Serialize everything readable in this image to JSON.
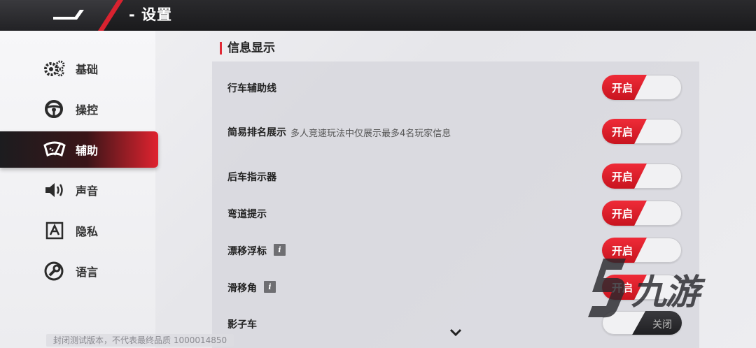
{
  "header": {
    "title": "- 设置"
  },
  "sidebar": {
    "items": [
      {
        "label": "基础",
        "icon": "gears-icon"
      },
      {
        "label": "操控",
        "icon": "steering-wheel-icon"
      },
      {
        "label": "辅助",
        "icon": "wiper-icon",
        "active": true
      },
      {
        "label": "声音",
        "icon": "speaker-icon"
      },
      {
        "label": "隐私",
        "icon": "privacy-icon"
      },
      {
        "label": "语言",
        "icon": "wrench-icon"
      }
    ]
  },
  "section": {
    "title": "信息显示",
    "rows": [
      {
        "name": "行车辅助线",
        "desc": "",
        "info": false,
        "state": "开启"
      },
      {
        "name": "简易排名展示",
        "desc": "多人竞速玩法中仅展示最多4名玩家信息",
        "info": false,
        "state": "开启"
      },
      {
        "name": "后车指示器",
        "desc": "",
        "info": false,
        "state": "开启"
      },
      {
        "name": "弯道提示",
        "desc": "",
        "info": false,
        "state": "开启"
      },
      {
        "name": "漂移浮标",
        "desc": "",
        "info": true,
        "state": "开启"
      },
      {
        "name": "滑移角",
        "desc": "",
        "info": true,
        "state": "开启"
      },
      {
        "name": "影子车",
        "desc": "",
        "info": false,
        "state": "关闭"
      }
    ],
    "info_glyph": "i"
  },
  "footer": {
    "note": "封闭测试版本，不代表最终品质 1000014850"
  },
  "watermark": {
    "text": "九游"
  },
  "colors": {
    "accent": "#e12a36",
    "dark": "#1e1e21",
    "panel": "#d6d6dc"
  }
}
